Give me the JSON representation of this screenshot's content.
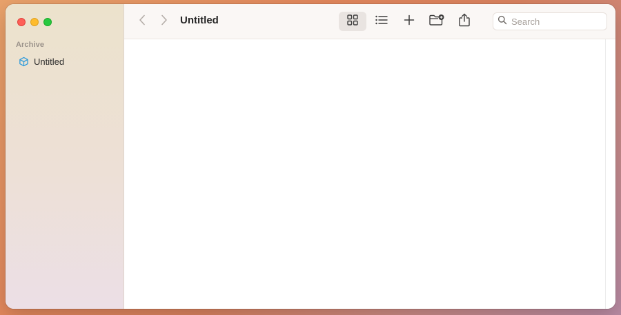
{
  "window": {
    "title": "Untitled"
  },
  "sidebar": {
    "section_label": "Archive",
    "items": [
      {
        "label": "Untitled",
        "icon": "cube-icon",
        "icon_color": "#2f9bdb"
      }
    ]
  },
  "toolbar": {
    "back_icon": "chevron-left-icon",
    "forward_icon": "chevron-right-icon",
    "view_grid_icon": "grid-view-icon",
    "view_list_icon": "list-view-icon",
    "add_icon": "plus-icon",
    "new_folder_icon": "new-folder-icon",
    "share_icon": "share-icon",
    "active_view": "grid"
  },
  "search": {
    "placeholder": "Search",
    "value": ""
  },
  "colors": {
    "close": "#fe5f57",
    "minimize": "#febc2e",
    "zoom": "#28c840",
    "accent": "#2f9bdb"
  }
}
